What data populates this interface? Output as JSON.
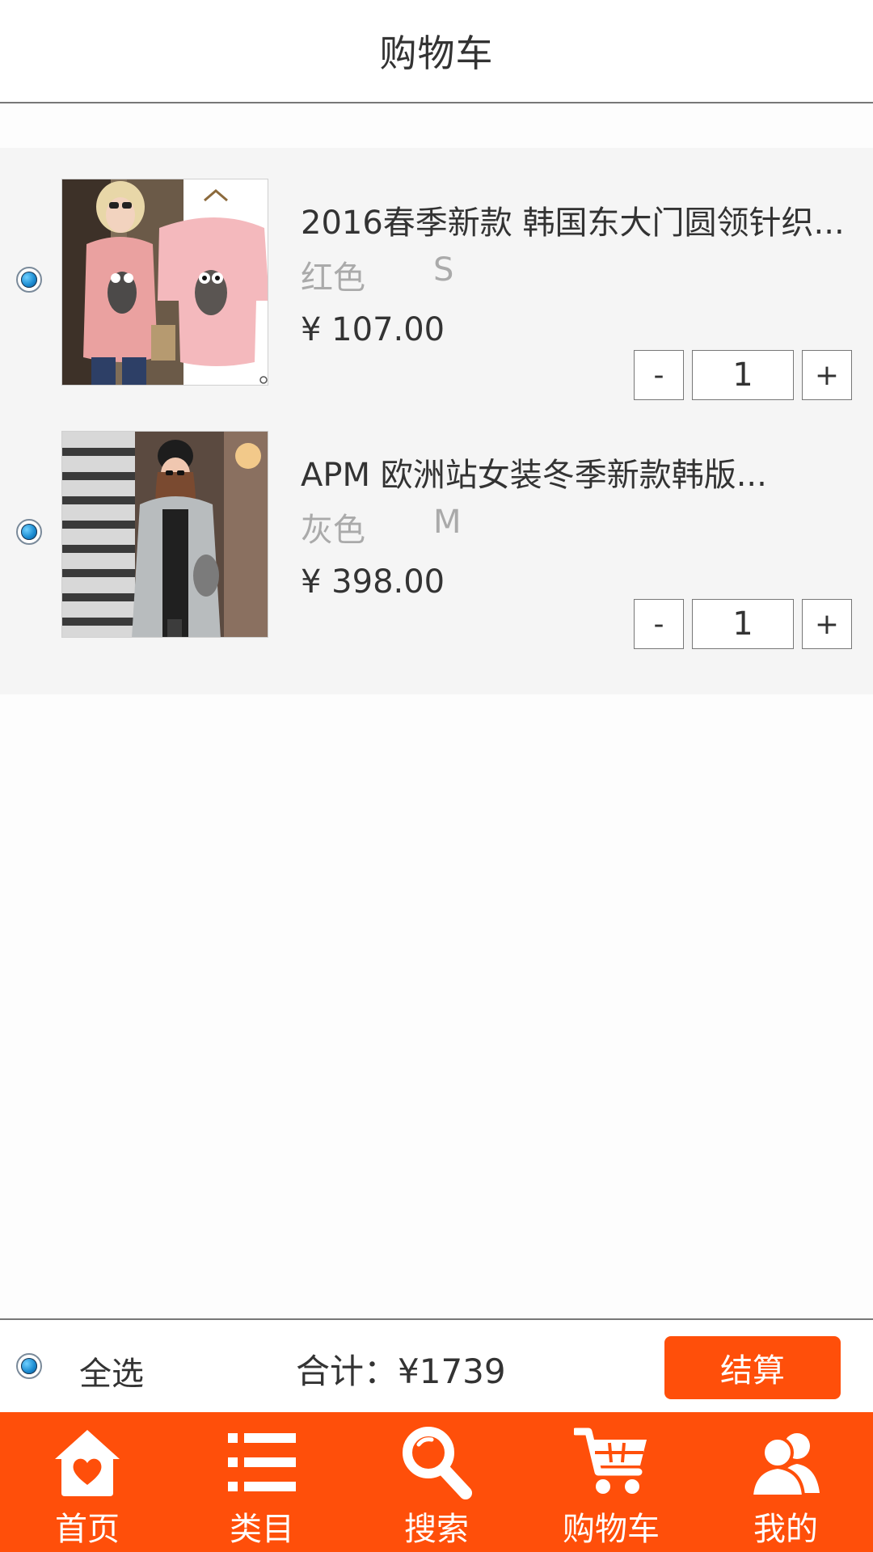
{
  "header": {
    "title": "购物车"
  },
  "cart": {
    "items": [
      {
        "title": "2016春季新款 韩国东大门圆领针织...",
        "color": "红色",
        "size": "S",
        "price": "¥  107.00",
        "quantity": "1",
        "minus_label": "-",
        "plus_label": "+",
        "selected": true
      },
      {
        "title": "APM 欧洲站女装冬季新款韩版...",
        "color": "灰色",
        "size": "M",
        "price": "¥  398.00",
        "quantity": "1",
        "minus_label": "-",
        "plus_label": "+",
        "selected": true
      }
    ]
  },
  "checkout": {
    "select_all_label": "全选",
    "total_label": "合计：",
    "total_value": "¥1739",
    "button_label": "结算"
  },
  "nav": {
    "items": [
      {
        "label": "首页",
        "icon": "home-icon"
      },
      {
        "label": "类目",
        "icon": "list-icon"
      },
      {
        "label": "搜索",
        "icon": "search-icon"
      },
      {
        "label": "购物车",
        "icon": "cart-icon"
      },
      {
        "label": "我的",
        "icon": "user-icon"
      }
    ]
  },
  "colors": {
    "accent": "#ff4f0a",
    "header_border": "#777777",
    "list_background": "#f5f5f5"
  }
}
